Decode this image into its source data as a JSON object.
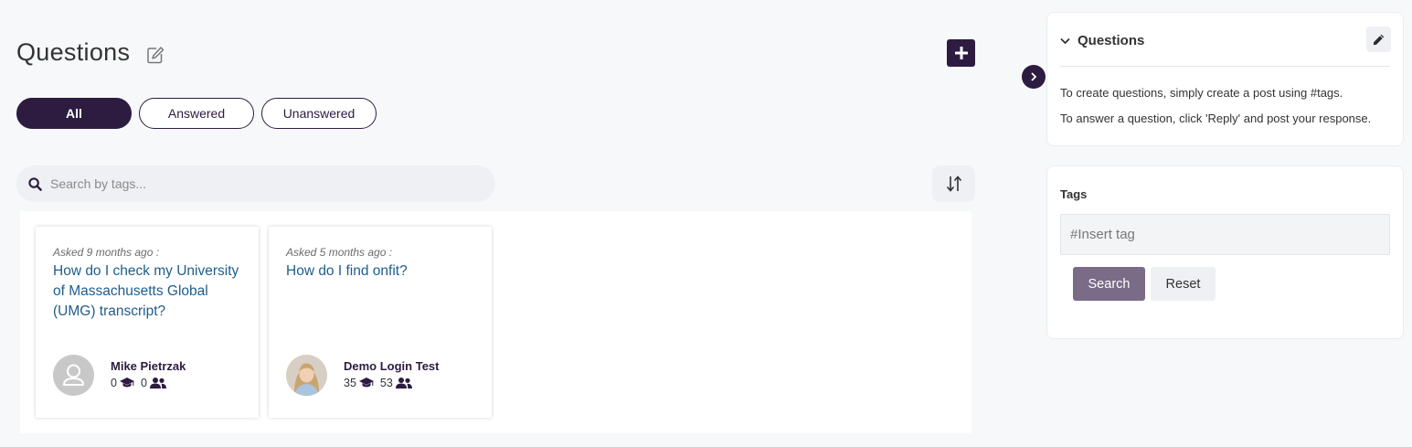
{
  "page": {
    "title": "Questions",
    "filters": [
      {
        "label": "All",
        "active": true
      },
      {
        "label": "Answered",
        "active": false
      },
      {
        "label": "Unanswered",
        "active": false
      }
    ],
    "search": {
      "placeholder": "Search by tags..."
    }
  },
  "questions": [
    {
      "asked": "Asked 9 months ago :",
      "title": "How do I check my University of Massachusetts Global (UMG) transcript?",
      "author": "Mike Pietrzak",
      "avatar": "default-user-icon",
      "learning_count": "0",
      "connections_count": "0"
    },
    {
      "asked": "Asked 5 months ago :",
      "title": "How do I find onfit?",
      "author": "Demo Login Test",
      "avatar": "user-photo",
      "learning_count": "35",
      "connections_count": "53"
    }
  ],
  "sidebar": {
    "questions_panel": {
      "title": "Questions",
      "line1": "To create questions, simply create a post using #tags.",
      "line2": "To answer a question, click 'Reply' and post your response."
    },
    "tags_panel": {
      "label": "Tags",
      "placeholder": "#Insert tag",
      "search_label": "Search",
      "reset_label": "Reset"
    }
  },
  "colors": {
    "brand": "#2d1b40",
    "link": "#1f5d8a",
    "search_button": "#7a6b87"
  }
}
